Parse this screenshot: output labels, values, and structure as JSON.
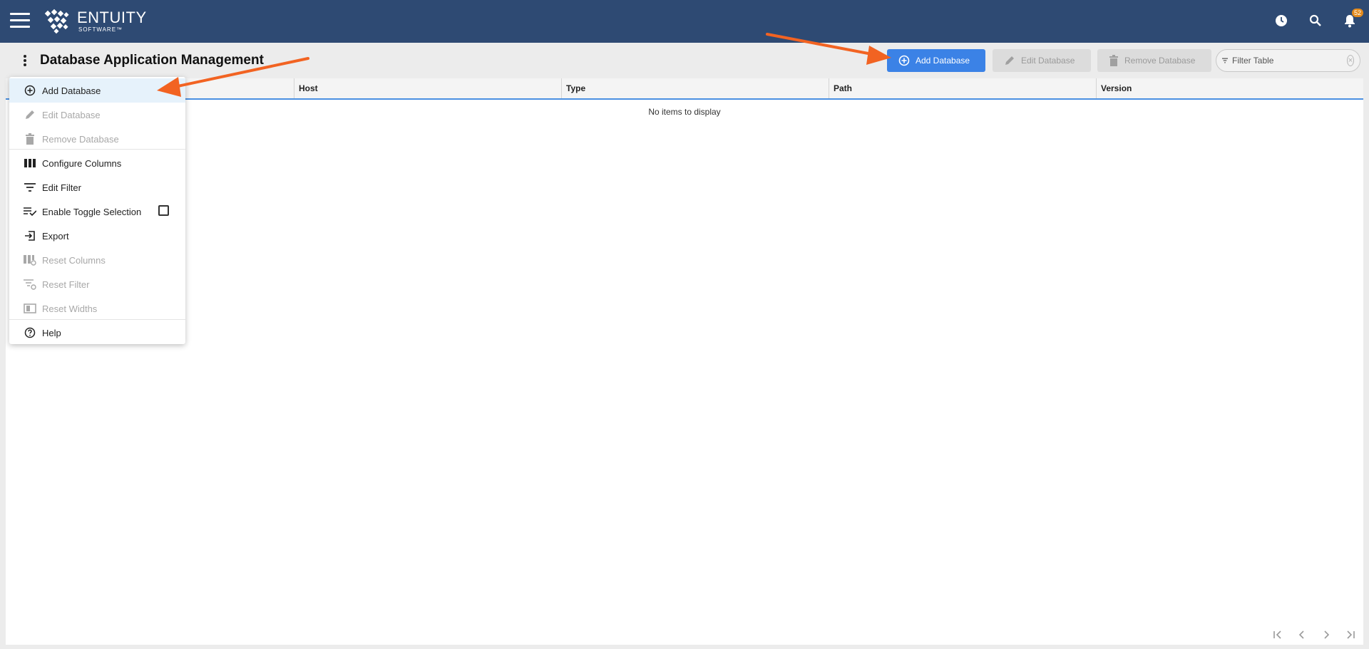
{
  "app": {
    "logo_name": "ENTUITY",
    "logo_sub": "SOFTWARE™",
    "notification_count": "52"
  },
  "header": {
    "title": "Database Application Management"
  },
  "toolbar": {
    "add_label": "Add Database",
    "edit_label": "Edit Database",
    "remove_label": "Remove Database",
    "filter_placeholder": "Filter Table"
  },
  "table": {
    "columns": [
      "",
      "Host",
      "Type",
      "Path",
      "Version"
    ],
    "empty_message": "No items to display"
  },
  "menu": {
    "items": [
      {
        "label": "Add Database",
        "icon": "add-circle-icon",
        "enabled": true
      },
      {
        "label": "Edit Database",
        "icon": "pencil-icon",
        "enabled": false
      },
      {
        "label": "Remove Database",
        "icon": "trash-icon",
        "enabled": false
      },
      {
        "label": "Configure Columns",
        "icon": "columns-icon",
        "enabled": true
      },
      {
        "label": "Edit Filter",
        "icon": "filter-icon",
        "enabled": true
      },
      {
        "label": "Enable Toggle Selection",
        "icon": "toggle-selection-icon",
        "enabled": true
      },
      {
        "label": "Export",
        "icon": "export-icon",
        "enabled": true
      },
      {
        "label": "Reset Columns",
        "icon": "reset-columns-icon",
        "enabled": false
      },
      {
        "label": "Reset Filter",
        "icon": "reset-filter-icon",
        "enabled": false
      },
      {
        "label": "Reset Widths",
        "icon": "reset-widths-icon",
        "enabled": false
      },
      {
        "label": "Help",
        "icon": "help-icon",
        "enabled": true
      }
    ]
  },
  "colors": {
    "topbar": "#2e4a73",
    "primary": "#3b82e6",
    "annotation_arrow": "#f26322"
  }
}
